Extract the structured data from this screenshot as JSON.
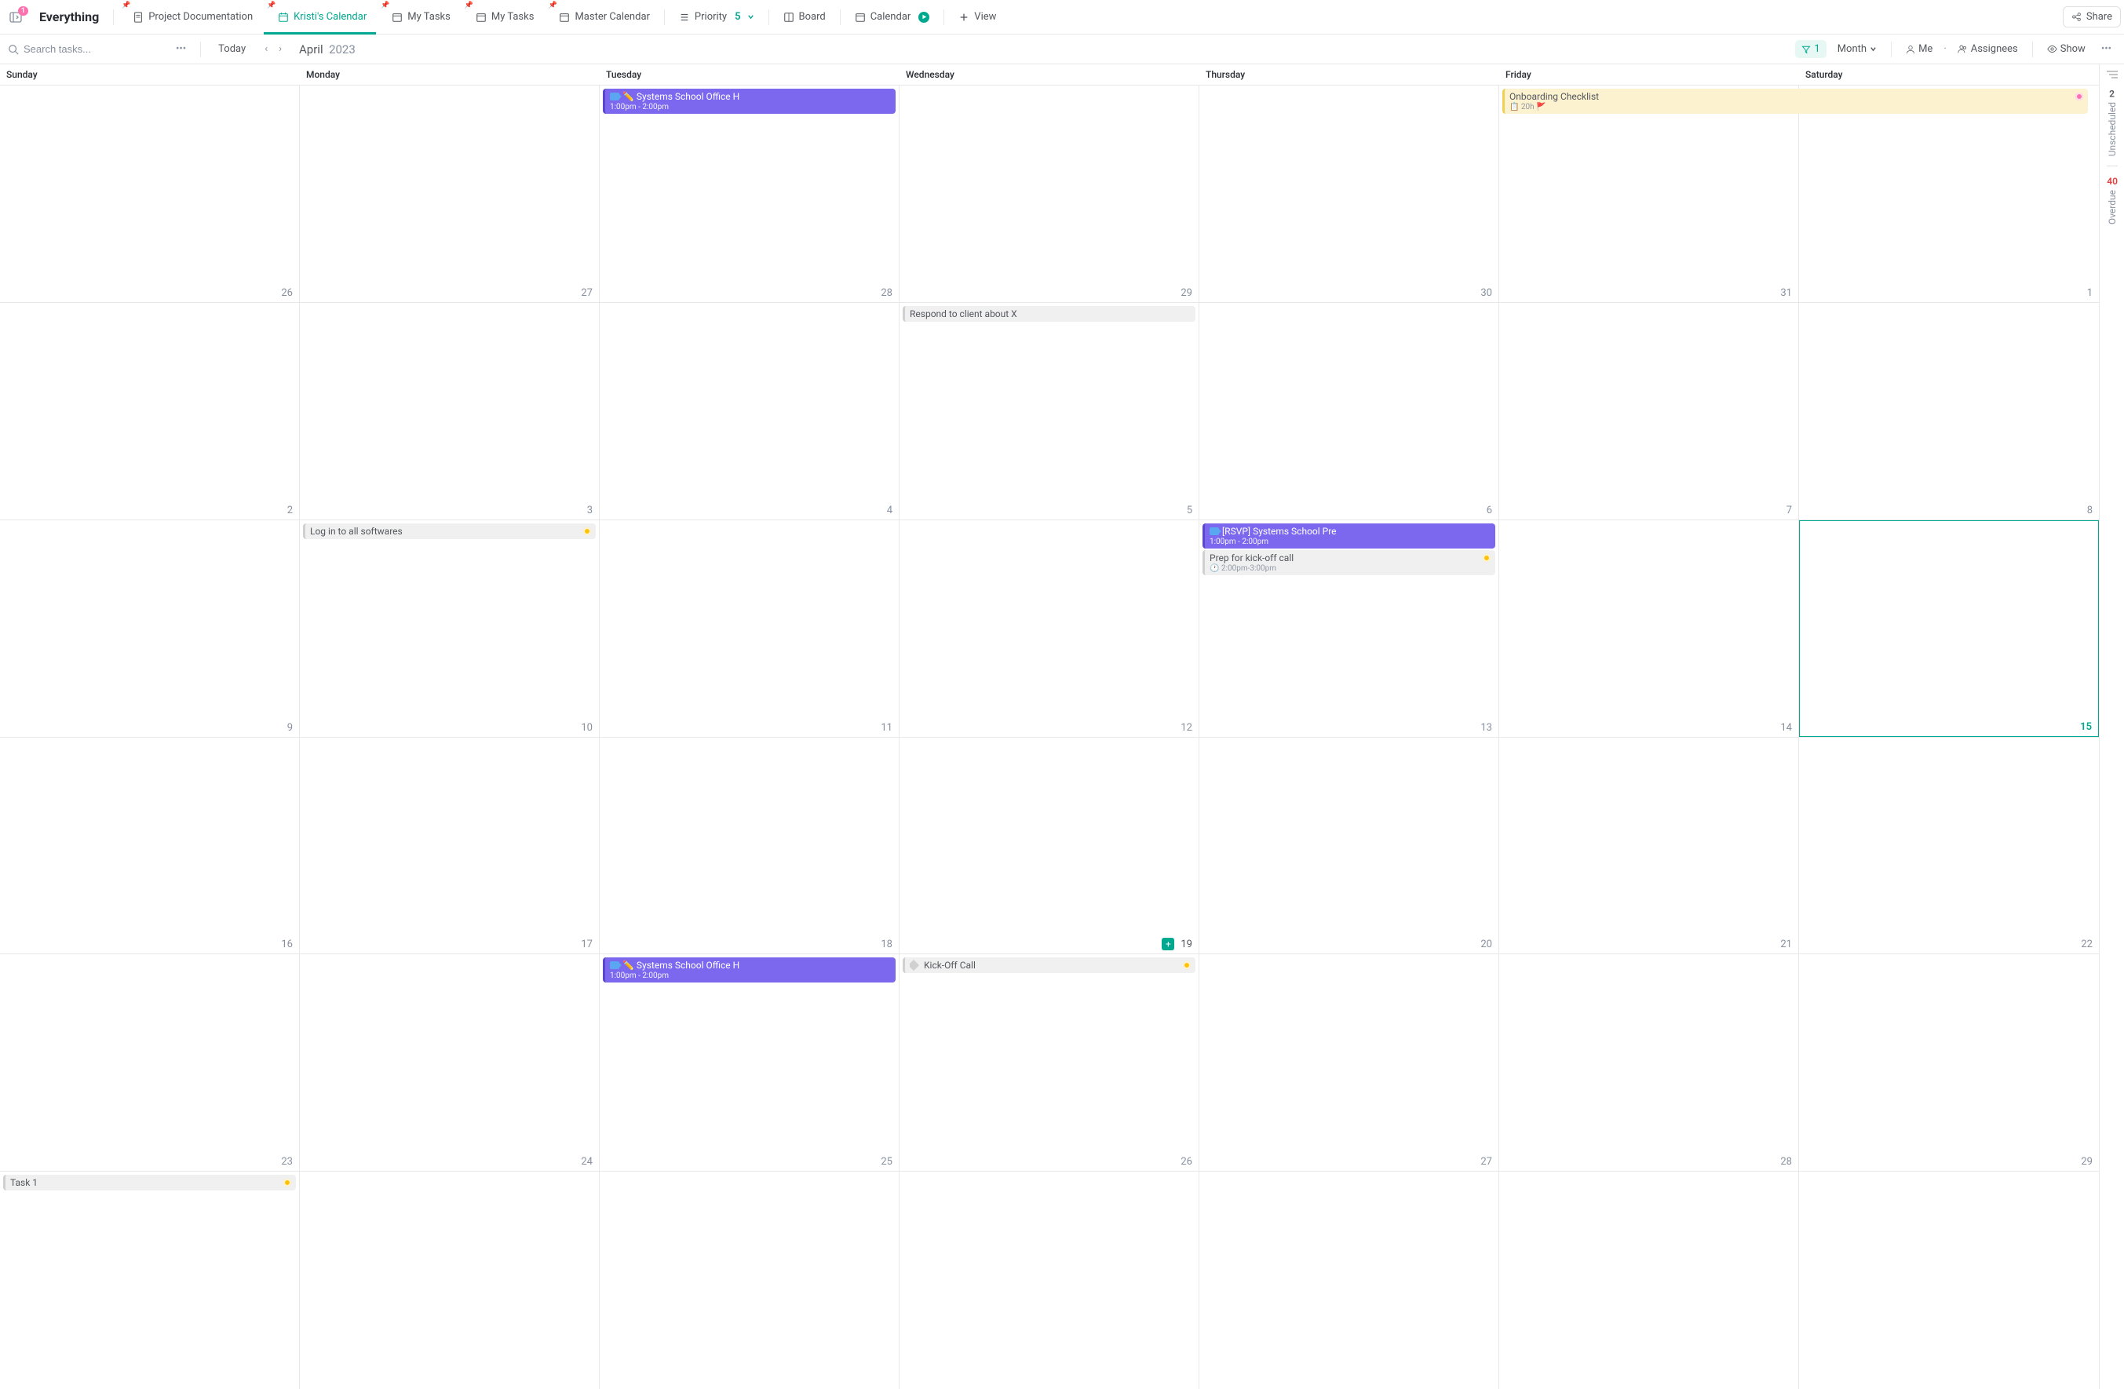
{
  "sidebar_badge": "1",
  "tabs": {
    "everything": "Everything",
    "project_docs": "Project Documentation",
    "kristi": "Kristi's Calendar",
    "my_tasks_1": "My Tasks",
    "my_tasks_2": "My Tasks",
    "master_cal": "Master Calendar",
    "priority": "Priority",
    "priority_count": "5",
    "board": "Board",
    "calendar": "Calendar",
    "view": "View",
    "share": "Share"
  },
  "toolbar": {
    "search_placeholder": "Search tasks...",
    "today": "Today",
    "month": "April",
    "year": "2023",
    "filter_count": "1",
    "view_mode": "Month",
    "me": "Me",
    "assignees": "Assignees",
    "show": "Show"
  },
  "weekdays": [
    "Sunday",
    "Monday",
    "Tuesday",
    "Wednesday",
    "Thursday",
    "Friday",
    "Saturday"
  ],
  "grid": [
    [
      {
        "n": "26"
      },
      {
        "n": "27"
      },
      {
        "n": "28"
      },
      {
        "n": "29"
      },
      {
        "n": "30"
      },
      {
        "n": "31"
      },
      {
        "n": "1"
      }
    ],
    [
      {
        "n": "2"
      },
      {
        "n": "3"
      },
      {
        "n": "4"
      },
      {
        "n": "5"
      },
      {
        "n": "6"
      },
      {
        "n": "7"
      },
      {
        "n": "8"
      }
    ],
    [
      {
        "n": "9"
      },
      {
        "n": "10"
      },
      {
        "n": "11"
      },
      {
        "n": "12"
      },
      {
        "n": "13"
      },
      {
        "n": "14"
      },
      {
        "n": "15",
        "today": true
      }
    ],
    [
      {
        "n": "16"
      },
      {
        "n": "17"
      },
      {
        "n": "18"
      },
      {
        "n": "19",
        "add": true
      },
      {
        "n": "20"
      },
      {
        "n": "21"
      },
      {
        "n": "22"
      }
    ],
    [
      {
        "n": "23"
      },
      {
        "n": "24"
      },
      {
        "n": "25"
      },
      {
        "n": "26"
      },
      {
        "n": "27"
      },
      {
        "n": "28"
      },
      {
        "n": "29"
      }
    ],
    [
      {
        "n": ""
      },
      {
        "n": ""
      },
      {
        "n": ""
      },
      {
        "n": ""
      },
      {
        "n": ""
      },
      {
        "n": ""
      },
      {
        "n": ""
      }
    ]
  ],
  "events": {
    "systems_office": {
      "title": "✏️ Systems School Office H",
      "time": "1:00pm - 2:00pm"
    },
    "onboarding": {
      "title": "Onboarding Checklist",
      "meta": "20h",
      "flag": "🚩"
    },
    "respond_client": {
      "title": "Respond to client about X"
    },
    "login_softwares": {
      "title": "Log in to all softwares"
    },
    "rsvp": {
      "title": "[RSVP] Systems School Pre",
      "time": "1:00pm - 2:00pm"
    },
    "prep_kickoff": {
      "title": "Prep for kick-off call",
      "time": "2:00pm-3:00pm"
    },
    "kickoff": {
      "title": "Kick-Off Call"
    },
    "task1": {
      "title": "Task 1"
    }
  },
  "rail": {
    "unscheduled_label": "Unscheduled",
    "unscheduled_count": "2",
    "overdue_label": "Overdue",
    "overdue_count": "40"
  }
}
